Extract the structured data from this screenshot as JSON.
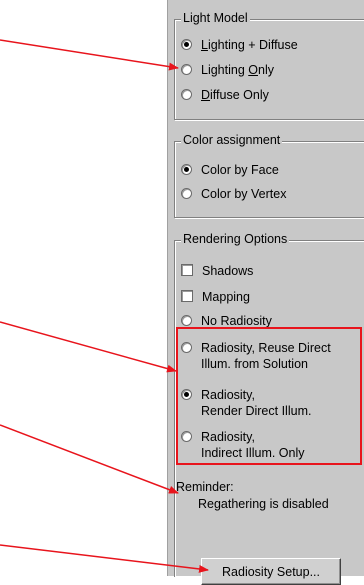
{
  "light_model": {
    "title": "Light Model",
    "options": [
      {
        "pre": "",
        "u": "L",
        "post": "ighting + Diffuse",
        "checked": true
      },
      {
        "pre": "Lighting ",
        "u": "O",
        "post": "nly",
        "checked": false
      },
      {
        "pre": "",
        "u": "D",
        "post": "iffuse Only",
        "checked": false
      }
    ]
  },
  "color_assignment": {
    "title": "Color assignment",
    "options": [
      {
        "label": "Color by Face",
        "checked": true
      },
      {
        "label": "Color by Vertex",
        "checked": false
      }
    ]
  },
  "rendering_options": {
    "title": "Rendering Options",
    "shadows": "Shadows",
    "mapping": "Mapping",
    "no_radiosity": "No Radiosity",
    "radiosity_reuse_line1": "Radiosity, Reuse Direct",
    "radiosity_reuse_line2": "Illum. from Solution",
    "radiosity_render_line1": "Radiosity,",
    "radiosity_render_line2": "Render Direct Illum.",
    "radiosity_indirect_line1": "Radiosity,",
    "radiosity_indirect_line2": "Indirect Illum. Only"
  },
  "reminder": {
    "label": "Reminder:",
    "text": "Regathering is disabled"
  },
  "radiosity_setup_button": "Radiosity Setup...",
  "colors": {
    "annotation_red": "#e8141c",
    "panel_bg": "#c8c8c8"
  }
}
